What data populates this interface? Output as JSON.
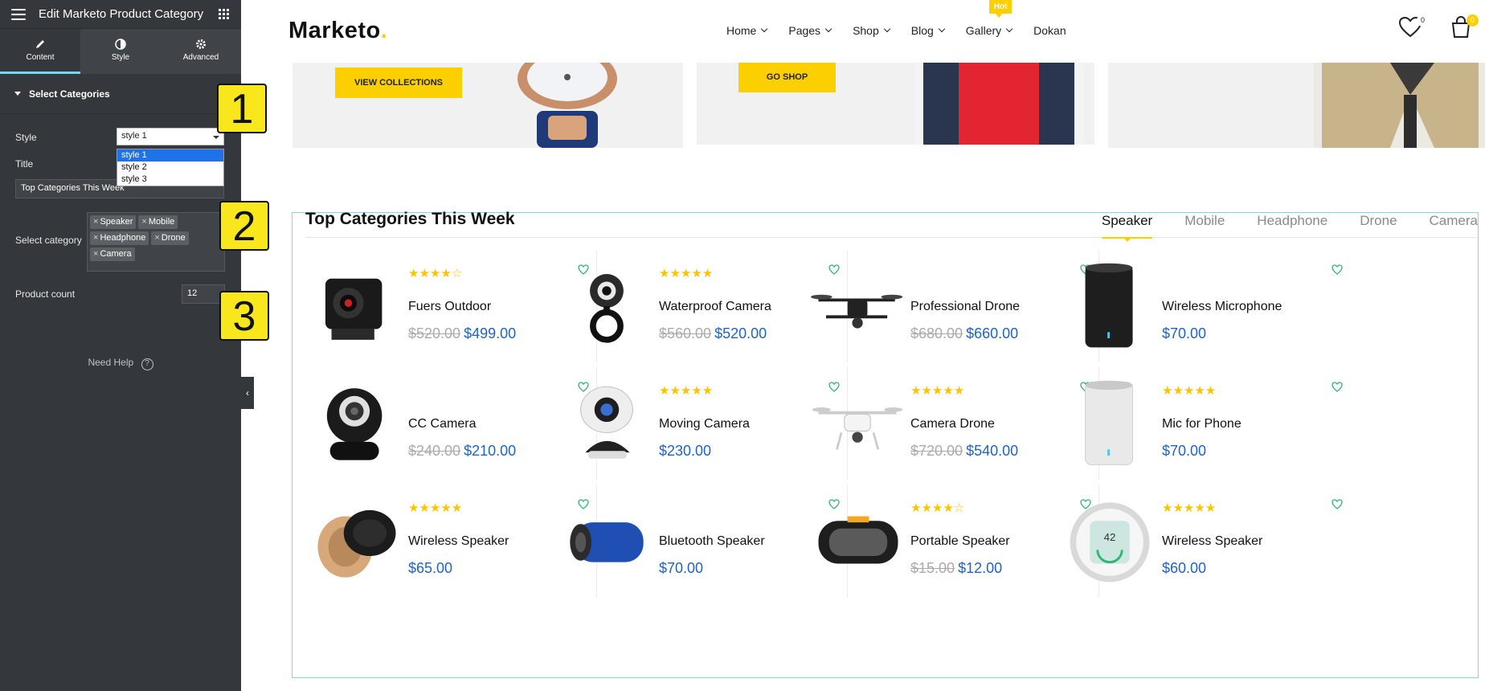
{
  "editor": {
    "title": "Edit Marketo Product Category",
    "tabs": [
      {
        "label": "Content",
        "icon": "pencil-icon"
      },
      {
        "label": "Style",
        "icon": "half-circle-icon"
      },
      {
        "label": "Advanced",
        "icon": "gear-icon"
      }
    ],
    "section": "Select Categories",
    "style_label": "Style",
    "style_value": "style 1",
    "style_options": [
      "style 1",
      "style 2",
      "style 3"
    ],
    "title_label": "Title",
    "title_value": "Top Categories This Week",
    "category_label": "Select category",
    "categories": [
      "Speaker",
      "Mobile",
      "Headphone",
      "Drone",
      "Camera"
    ],
    "count_label": "Product count",
    "count_value": "12",
    "need_help": "Need Help",
    "help_icon_text": "?",
    "collapse_icon": "‹"
  },
  "steps": [
    "1",
    "2",
    "3"
  ],
  "site": {
    "logo": "Marketo",
    "logo_dot": ".",
    "nav": [
      {
        "label": "Home",
        "dropdown": true
      },
      {
        "label": "Pages",
        "dropdown": true
      },
      {
        "label": "Shop",
        "dropdown": true
      },
      {
        "label": "Blog",
        "dropdown": true
      },
      {
        "label": "Gallery",
        "dropdown": true,
        "badge": "Hot"
      },
      {
        "label": "Dokan",
        "dropdown": false
      }
    ],
    "wishlist_count": "0",
    "cart_count": "0",
    "banners": {
      "btn1": "VIEW COLLECTIONS",
      "btn2": "GO SHOP"
    },
    "panel_title": "Top Categories This Week",
    "panel_tabs": [
      "Speaker",
      "Mobile",
      "Headphone",
      "Drone",
      "Camera"
    ],
    "products": [
      {
        "name": "Fuers Outdoor",
        "old": "$520.00",
        "price": "$499.00",
        "rating": 4,
        "img": "action-camera"
      },
      {
        "name": "Waterproof Camera",
        "old": "$560.00",
        "price": "$520.00",
        "rating": 5,
        "img": "webcam"
      },
      {
        "name": "Professional Drone",
        "old": "$680.00",
        "price": "$660.00",
        "rating": 0,
        "img": "drone"
      },
      {
        "name": "Wireless Microphone",
        "old": "",
        "price": "$70.00",
        "rating": 0,
        "img": "cylinder-black"
      },
      {
        "name": "CC Camera",
        "old": "$240.00",
        "price": "$210.00",
        "rating": 0,
        "img": "sphere-camera"
      },
      {
        "name": "Moving Camera",
        "old": "",
        "price": "$230.00",
        "rating": 5,
        "img": "webcam-white"
      },
      {
        "name": "Camera Drone",
        "old": "$720.00",
        "price": "$540.00",
        "rating": 5,
        "img": "drone-white"
      },
      {
        "name": "Mic for Phone",
        "old": "",
        "price": "$70.00",
        "rating": 5,
        "img": "cylinder-white"
      },
      {
        "name": "Wireless Speaker",
        "old": "",
        "price": "$65.00",
        "rating": 5,
        "img": "puck-speaker"
      },
      {
        "name": "Bluetooth Speaker",
        "old": "",
        "price": "$70.00",
        "rating": 0,
        "img": "tube-speaker"
      },
      {
        "name": "Portable Speaker",
        "old": "$15.00",
        "price": "$12.00",
        "rating": 4,
        "img": "box-speaker"
      },
      {
        "name": "Wireless Speaker",
        "old": "",
        "price": "$60.00",
        "rating": 5,
        "img": "clock-speaker"
      }
    ],
    "accent": "#fcd000",
    "price_color": "#1e63c9"
  }
}
